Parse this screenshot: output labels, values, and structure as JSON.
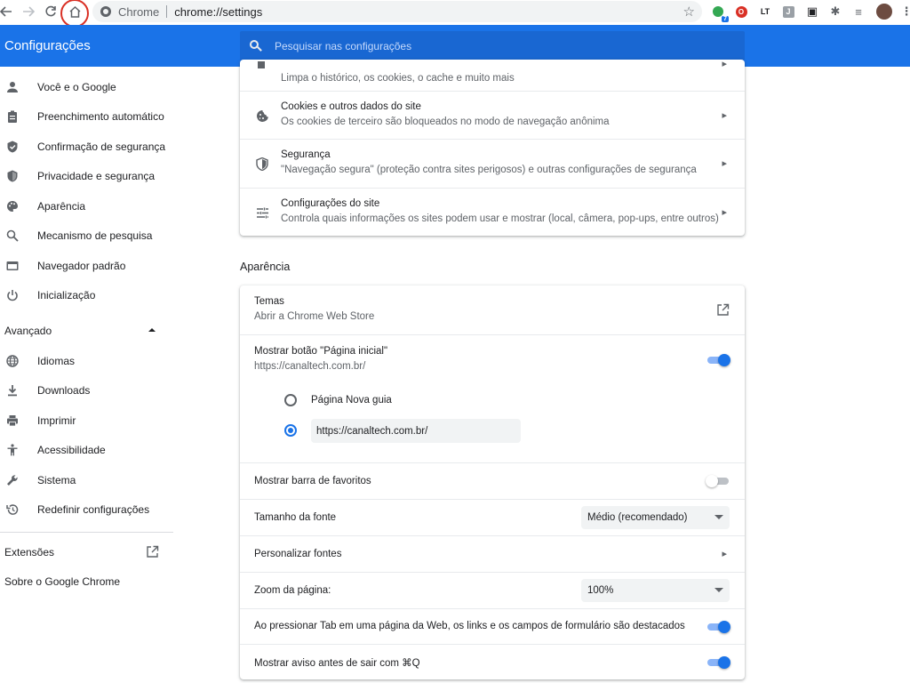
{
  "browser": {
    "omnibox_site": "Chrome",
    "omnibox_url": "chrome://settings"
  },
  "extensions": [
    {
      "name": "green-extension-icon",
      "color": "#34a853",
      "badge": "7"
    },
    {
      "name": "opera-style-extension-icon",
      "color": "#d93025",
      "glyph": "O"
    },
    {
      "name": "lt-extension-icon",
      "color": "#202124",
      "glyph": "LT"
    },
    {
      "name": "j-extension-icon",
      "color": "#9aa0a6",
      "glyph": "J"
    },
    {
      "name": "picture-in-picture-icon",
      "color": "#202124",
      "glyph": "▣"
    },
    {
      "name": "puzzle-extensions-icon",
      "color": "#5f6368",
      "glyph": "✱"
    },
    {
      "name": "media-queue-icon",
      "color": "#5f6368",
      "glyph": "≡"
    }
  ],
  "header": {
    "title": "Configurações",
    "search_placeholder": "Pesquisar nas configurações"
  },
  "sidebar": {
    "items": [
      {
        "label": "Você e o Google",
        "icon": "person-icon"
      },
      {
        "label": "Preenchimento automático",
        "icon": "clipboard-icon"
      },
      {
        "label": "Confirmação de segurança",
        "icon": "shield-check-icon"
      },
      {
        "label": "Privacidade e segurança",
        "icon": "shield-icon"
      },
      {
        "label": "Aparência",
        "icon": "palette-icon"
      },
      {
        "label": "Mecanismo de pesquisa",
        "icon": "search-icon"
      },
      {
        "label": "Navegador padrão",
        "icon": "browser-window-icon"
      },
      {
        "label": "Inicialização",
        "icon": "power-icon"
      }
    ],
    "advanced_label": "Avançado",
    "advanced_items": [
      {
        "label": "Idiomas",
        "icon": "globe-icon"
      },
      {
        "label": "Downloads",
        "icon": "download-icon"
      },
      {
        "label": "Imprimir",
        "icon": "printer-icon"
      },
      {
        "label": "Acessibilidade",
        "icon": "accessibility-icon"
      },
      {
        "label": "Sistema",
        "icon": "wrench-icon"
      },
      {
        "label": "Redefinir configurações",
        "icon": "restore-icon"
      }
    ],
    "extensions_label": "Extensões",
    "about_label": "Sobre o Google Chrome"
  },
  "privacy_card": {
    "partial_row_sub": "Limpa o histórico, os cookies, o cache e muito mais",
    "rows": [
      {
        "title": "Cookies e outros dados do site",
        "sub": "Os cookies de terceiro são bloqueados no modo de navegação anônima",
        "icon": "cookie-icon"
      },
      {
        "title": "Segurança",
        "sub": "\"Navegação segura\" (proteção contra sites perigosos) e outras configurações de segurança",
        "icon": "shield-icon"
      },
      {
        "title": "Configurações do site",
        "sub": "Controla quais informações os sites podem usar e mostrar (local, câmera, pop-ups, entre outros)",
        "icon": "tune-sliders-icon"
      }
    ]
  },
  "appearance": {
    "section_title": "Aparência",
    "themes_title": "Temas",
    "themes_sub": "Abrir a Chrome Web Store",
    "home_button_title": "Mostrar botão \"Página inicial\"",
    "home_button_sub": "https://canaltech.com.br/",
    "home_button_on": true,
    "radio_new_tab_label": "Página Nova guia",
    "radio_custom_url_value": "https://canaltech.com.br/",
    "radio_selected": "custom",
    "bookmarks_bar_label": "Mostrar barra de favoritos",
    "bookmarks_bar_on": false,
    "font_size_label": "Tamanho da fonte",
    "font_size_value": "Médio (recomendado)",
    "customize_fonts_label": "Personalizar fontes",
    "zoom_label": "Zoom da página:",
    "zoom_value": "100%",
    "tab_highlight_label": "Ao pressionar Tab em uma página da Web, os links e os campos de formulário são destacados",
    "tab_highlight_on": true,
    "quit_warning_label": "Mostrar aviso antes de sair com ⌘Q",
    "quit_warning_on": true
  },
  "colors": {
    "accent": "#1a73e8",
    "header_bg": "#1a73e8",
    "highlight_circle": "#d93025"
  }
}
